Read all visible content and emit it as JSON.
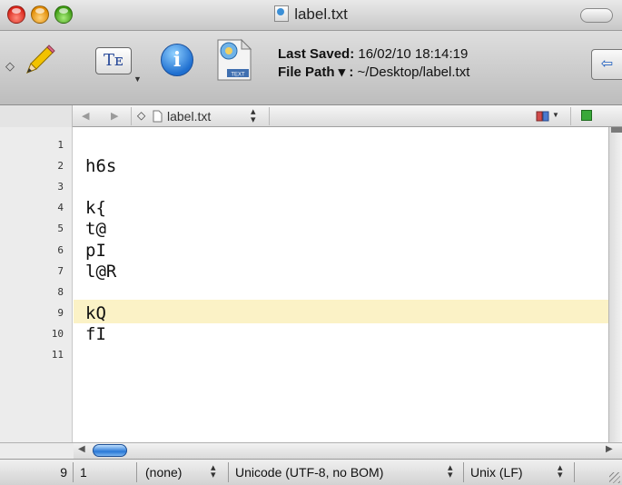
{
  "window": {
    "title": "label.txt"
  },
  "toolbar": {
    "last_saved_label": "Last Saved:",
    "last_saved_value": "16/02/10 18:14:19",
    "file_path_label": "File Path ▾ :",
    "file_path_value": "~/Desktop/label.txt",
    "text_button_glyph": "Tᴇ",
    "info_button_glyph": "i",
    "file_icon_badge": "TEXT"
  },
  "nav": {
    "filename": "label.txt"
  },
  "editor": {
    "current_line": 9,
    "lines": [
      {
        "num": "1",
        "text": ""
      },
      {
        "num": "2",
        "text": "h6s"
      },
      {
        "num": "3",
        "text": ""
      },
      {
        "num": "4",
        "text": "k{"
      },
      {
        "num": "5",
        "text": "t@"
      },
      {
        "num": "6",
        "text": "pI"
      },
      {
        "num": "7",
        "text": "l@R"
      },
      {
        "num": "8",
        "text": ""
      },
      {
        "num": "9",
        "text": "kQ"
      },
      {
        "num": "10",
        "text": "fI"
      },
      {
        "num": "11",
        "text": ""
      }
    ]
  },
  "status": {
    "line": "9",
    "column": "1",
    "syntax": "(none)",
    "encoding": "Unicode (UTF-8, no BOM)",
    "line_endings": "Unix (LF)"
  },
  "icons": {
    "close": "close-button-icon",
    "minimize": "minimize-button-icon",
    "zoom": "zoom-button-icon",
    "pencil": "pencil-icon",
    "info": "info-icon",
    "file": "text-file-icon",
    "back": "back-arrow-icon",
    "bookmark": "bookmark-icon",
    "split": "split-view-icon"
  }
}
